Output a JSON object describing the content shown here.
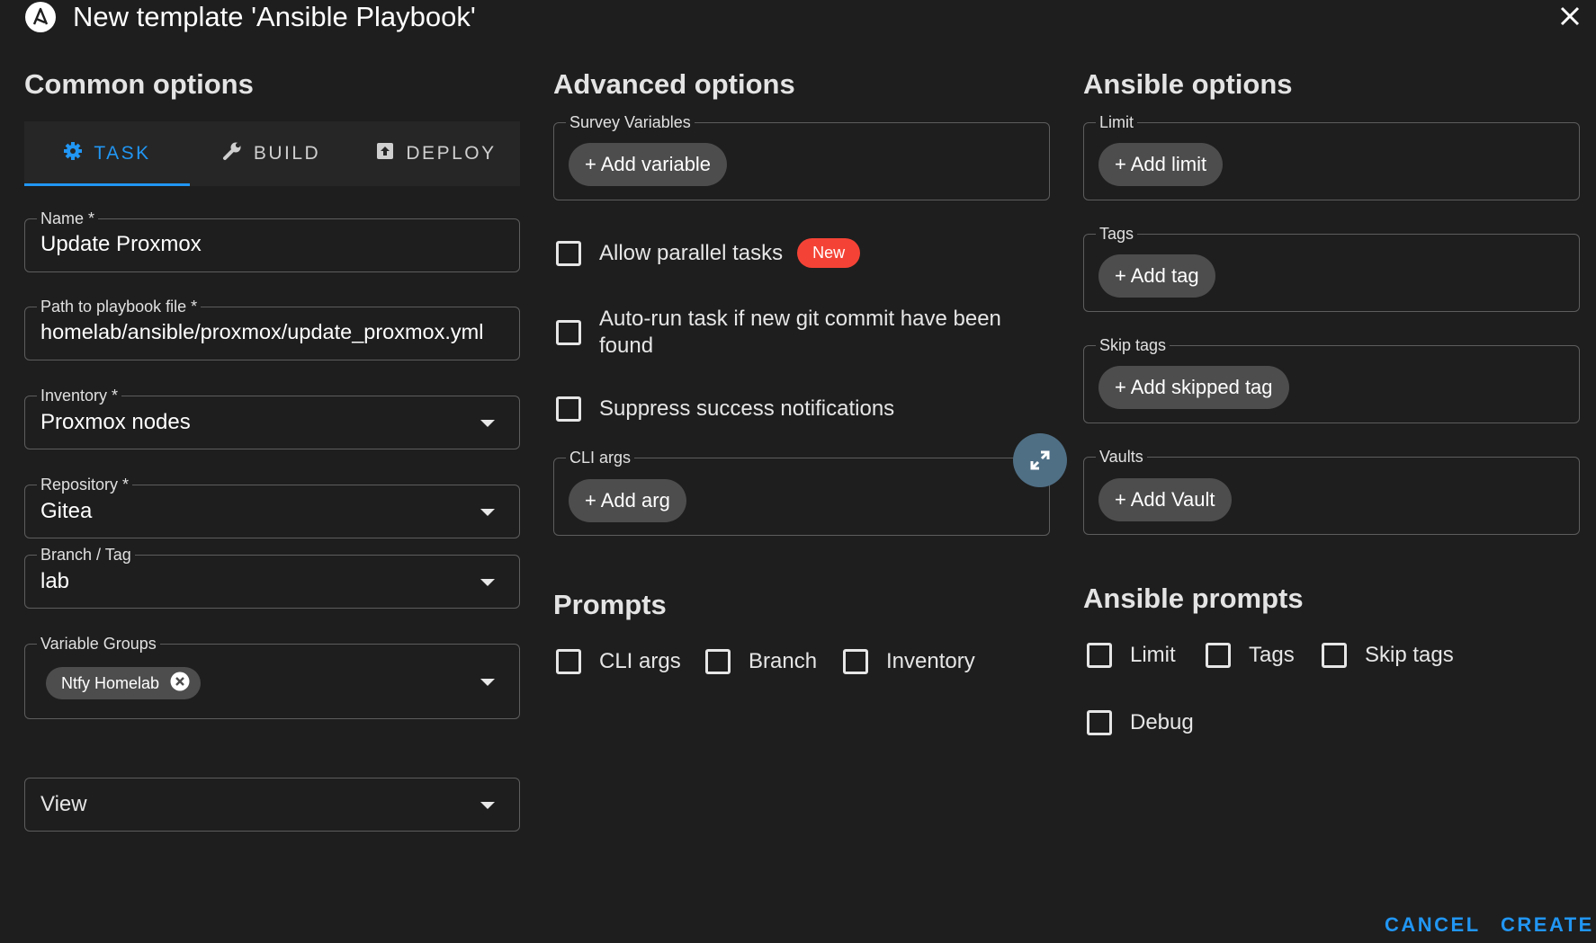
{
  "header": {
    "title": "New template 'Ansible Playbook'"
  },
  "common": {
    "title": "Common options",
    "tabs": [
      {
        "label": "TASK",
        "icon": "gear-icon",
        "active": true
      },
      {
        "label": "BUILD",
        "icon": "wrench-icon",
        "active": false
      },
      {
        "label": "DEPLOY",
        "icon": "deploy-icon",
        "active": false
      }
    ],
    "name": {
      "label": "Name *",
      "value": "Update Proxmox"
    },
    "playbook": {
      "label": "Path to playbook file *",
      "value": "homelab/ansible/proxmox/update_proxmox.yml"
    },
    "inventory": {
      "label": "Inventory *",
      "value": "Proxmox nodes"
    },
    "repository": {
      "label": "Repository *",
      "value": "Gitea"
    },
    "branch": {
      "label": "Branch / Tag",
      "value": "lab"
    },
    "variable_groups": {
      "label": "Variable Groups",
      "chip": "Ntfy Homelab"
    },
    "view": {
      "value": "View"
    }
  },
  "advanced": {
    "title": "Advanced options",
    "survey": {
      "label": "Survey Variables",
      "button": "+ Add variable"
    },
    "allow_parallel": {
      "label": "Allow parallel tasks",
      "badge": "New"
    },
    "autorun_line1": "Auto-run task if new git commit have been",
    "autorun_line2": "found",
    "suppress": "Suppress success notifications",
    "cli": {
      "label": "CLI args",
      "button": "+ Add arg"
    }
  },
  "prompts": {
    "title": "Prompts",
    "items": [
      "CLI args",
      "Branch",
      "Inventory"
    ]
  },
  "ansible": {
    "title": "Ansible options",
    "limit": {
      "label": "Limit",
      "button": "+ Add limit"
    },
    "tags": {
      "label": "Tags",
      "button": "+ Add tag"
    },
    "skip_tags": {
      "label": "Skip tags",
      "button": "+ Add skipped tag"
    },
    "vaults": {
      "label": "Vaults",
      "button": "+ Add Vault"
    }
  },
  "ansible_prompts": {
    "title": "Ansible prompts",
    "items": [
      "Limit",
      "Tags",
      "Skip tags",
      "Debug"
    ]
  },
  "footer": {
    "cancel": "CANCEL",
    "create": "CREATE"
  },
  "colors": {
    "accent": "#2196f3",
    "badge": "#f44336",
    "background": "#1e1e1e"
  }
}
